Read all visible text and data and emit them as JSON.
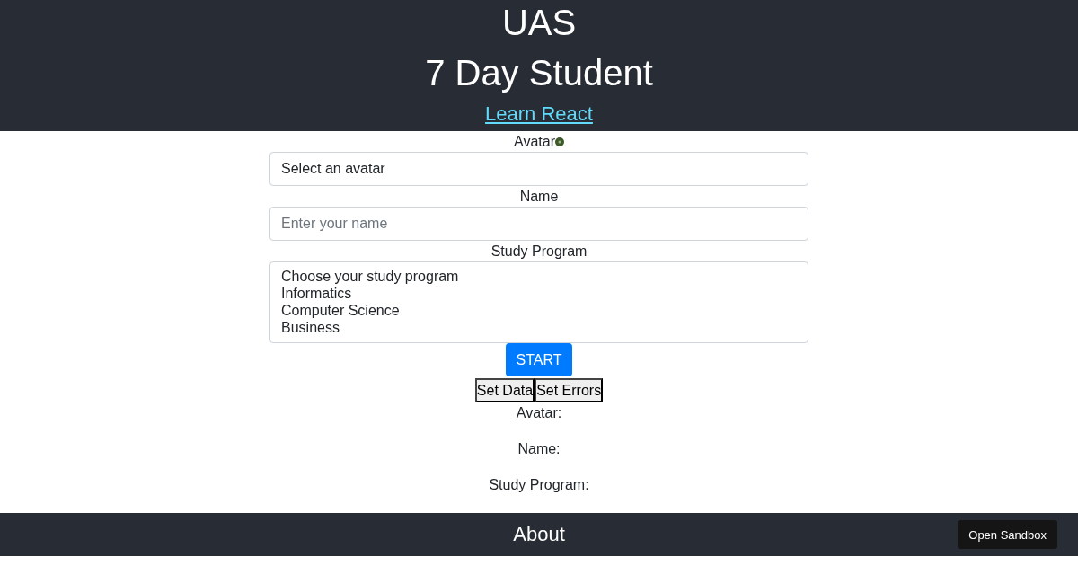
{
  "header": {
    "title": "UAS",
    "subtitle": "7 Day Student",
    "link": "Learn React"
  },
  "form": {
    "avatar_label": "Avatar",
    "avatar_select": "Select an avatar",
    "name_label": "Name",
    "name_placeholder": "Enter your name",
    "program_label": "Study Program",
    "program_options": [
      "Choose your study program",
      "Informatics",
      "Computer Science",
      "Business"
    ],
    "start_button": "START",
    "buttons": [
      "Set Data",
      "Set Errors"
    ]
  },
  "summary": [
    "Avatar:",
    "Name:",
    "Study Program:"
  ],
  "footer": {
    "title": "About",
    "sandbox_button": "Open Sandbox"
  }
}
